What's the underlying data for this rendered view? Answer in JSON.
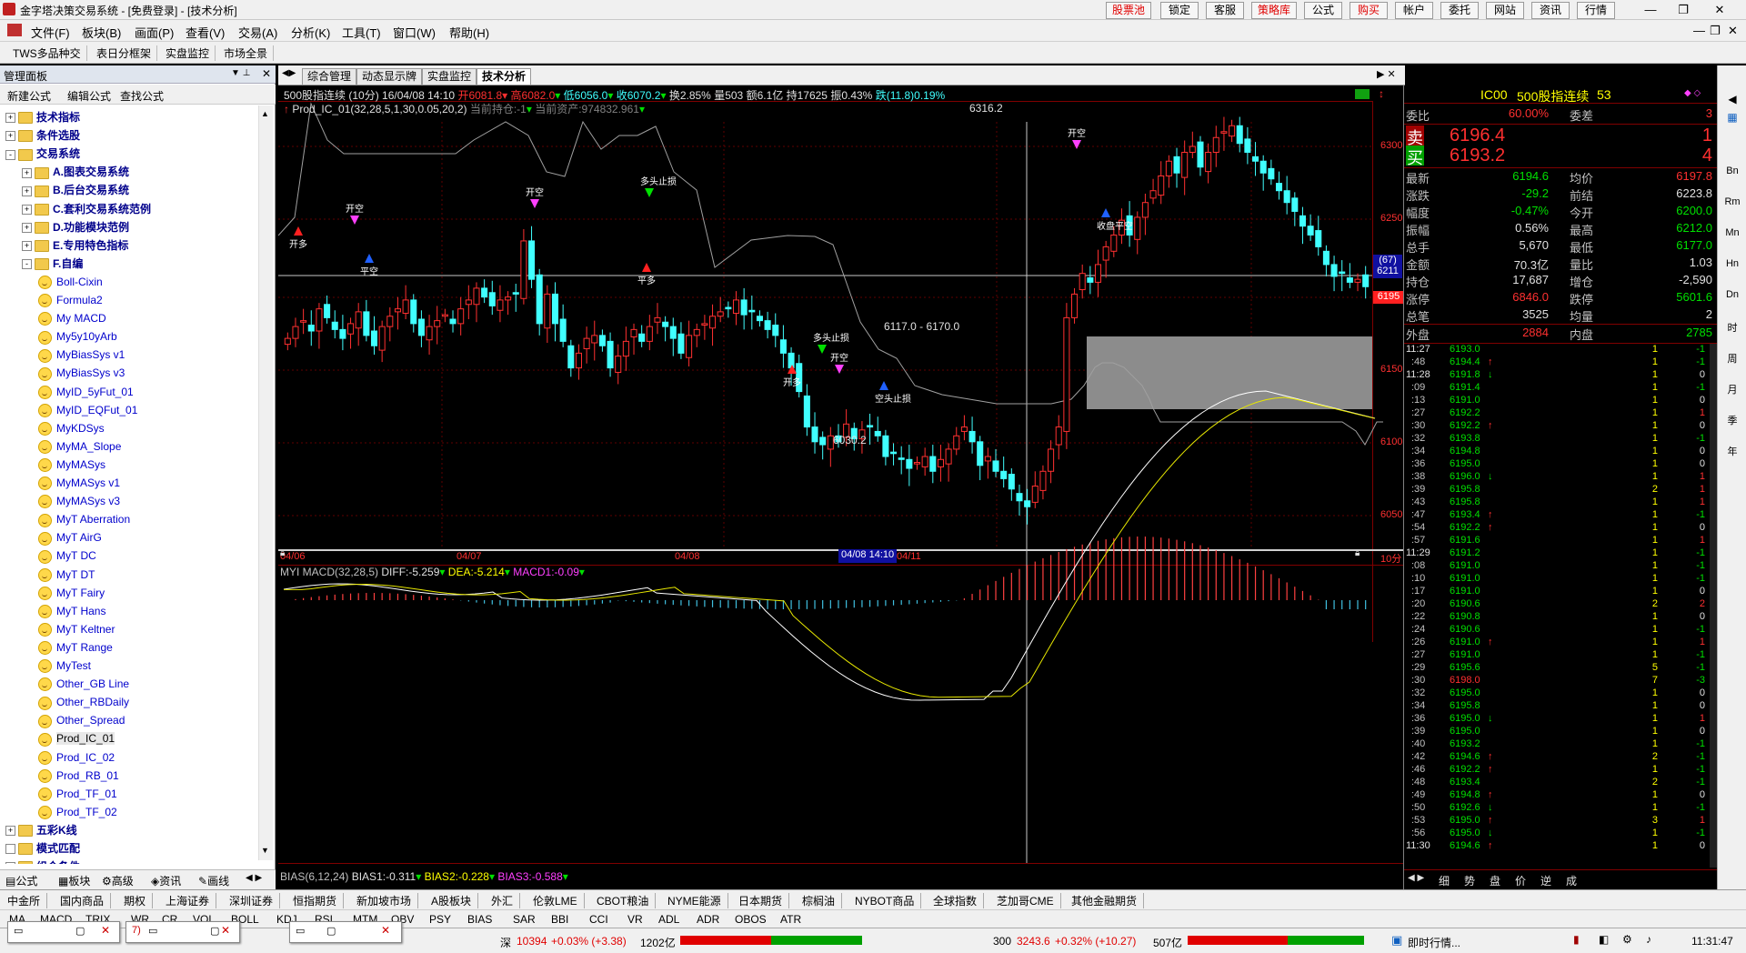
{
  "window": {
    "title": "金字塔决策交易系统 - [免费登录] - [技术分析]",
    "top_buttons": [
      "股票池",
      "锁定",
      "客服",
      "策略库",
      "公式",
      "购买",
      "帐户",
      "委托",
      "网站",
      "资讯",
      "行情"
    ],
    "controls": [
      "—",
      "❐",
      "✕"
    ]
  },
  "menu": {
    "items": [
      "文件(F)",
      "板块(B)",
      "画面(P)",
      "查看(V)",
      "交易(A)",
      "分析(K)",
      "工具(T)",
      "窗口(W)",
      "帮助(H)"
    ]
  },
  "toolbar_tabs": [
    "TWS多品种交",
    "表日分框架",
    "实盘监控",
    "市场全景"
  ],
  "left_panel": {
    "title": "管理面板",
    "tools": [
      "新建公式",
      "编辑公式",
      "查找公式"
    ],
    "tree": [
      {
        "level": 0,
        "type": "folder",
        "label": "技术指标",
        "sign": "+"
      },
      {
        "level": 0,
        "type": "folder",
        "label": "条件选股",
        "sign": "+"
      },
      {
        "level": 0,
        "type": "folder",
        "label": "交易系统",
        "sign": "-"
      },
      {
        "level": 1,
        "type": "folder",
        "label": "A.图表交易系统",
        "sign": "+"
      },
      {
        "level": 1,
        "type": "folder",
        "label": "B.后台交易系统",
        "sign": "+"
      },
      {
        "level": 1,
        "type": "folder",
        "label": "C.套利交易系统范例",
        "sign": "+"
      },
      {
        "level": 1,
        "type": "folder",
        "label": "D.功能模块范例",
        "sign": "+"
      },
      {
        "level": 1,
        "type": "folder",
        "label": "E.专用特色指标",
        "sign": "+"
      },
      {
        "level": 1,
        "type": "folder",
        "label": "F.自编",
        "sign": "-"
      },
      {
        "level": 2,
        "type": "item",
        "label": "Boll-Cixin"
      },
      {
        "level": 2,
        "type": "item",
        "label": "Formula2"
      },
      {
        "level": 2,
        "type": "item",
        "label": "My MACD"
      },
      {
        "level": 2,
        "type": "item",
        "label": "My5y10yArb"
      },
      {
        "level": 2,
        "type": "item",
        "label": "MyBiasSys v1"
      },
      {
        "level": 2,
        "type": "item",
        "label": "MyBiasSys v3"
      },
      {
        "level": 2,
        "type": "item",
        "label": "MyID_5yFut_01"
      },
      {
        "level": 2,
        "type": "item",
        "label": "MyID_EQFut_01"
      },
      {
        "level": 2,
        "type": "item",
        "label": "MyKDSys"
      },
      {
        "level": 2,
        "type": "item",
        "label": "MyMA_Slope"
      },
      {
        "level": 2,
        "type": "item",
        "label": "MyMASys"
      },
      {
        "level": 2,
        "type": "item",
        "label": "MyMASys v1"
      },
      {
        "level": 2,
        "type": "item",
        "label": "MyMASys v3"
      },
      {
        "level": 2,
        "type": "item",
        "label": "MyT Aberration"
      },
      {
        "level": 2,
        "type": "item",
        "label": "MyT AirG"
      },
      {
        "level": 2,
        "type": "item",
        "label": "MyT DC"
      },
      {
        "level": 2,
        "type": "item",
        "label": "MyT DT"
      },
      {
        "level": 2,
        "type": "item",
        "label": "MyT Fairy"
      },
      {
        "level": 2,
        "type": "item",
        "label": "MyT Hans"
      },
      {
        "level": 2,
        "type": "item",
        "label": "MyT Keltner"
      },
      {
        "level": 2,
        "type": "item",
        "label": "MyT Range"
      },
      {
        "level": 2,
        "type": "item",
        "label": "MyTest"
      },
      {
        "level": 2,
        "type": "item",
        "label": "Other_GB Line"
      },
      {
        "level": 2,
        "type": "item",
        "label": "Other_RBDaily"
      },
      {
        "level": 2,
        "type": "item",
        "label": "Other_Spread"
      },
      {
        "level": 2,
        "type": "item",
        "label": "Prod_IC_01"
      },
      {
        "level": 2,
        "type": "item",
        "label": "Prod_IC_02"
      },
      {
        "level": 2,
        "type": "item",
        "label": "Prod_RB_01"
      },
      {
        "level": 2,
        "type": "item",
        "label": "Prod_TF_01"
      },
      {
        "level": 2,
        "type": "item",
        "label": "Prod_TF_02"
      },
      {
        "level": 0,
        "type": "folder",
        "label": "五彩K线",
        "sign": "+"
      },
      {
        "level": 0,
        "type": "folder",
        "label": "模式匹配",
        "sign": " "
      },
      {
        "level": 0,
        "type": "folder",
        "label": "组合条件",
        "sign": " "
      }
    ],
    "bottom_tabs": [
      "公式",
      "板块",
      "高级",
      "资讯",
      "画线"
    ]
  },
  "chart_tabs": [
    "综合管理",
    "动态显示牌",
    "实盘监控",
    "技术分析"
  ],
  "chart": {
    "header": "500股指连续 (10分) 16/04/08 14:10",
    "hdr_open": "开6081.8",
    "hdr_high": "高6082.0",
    "hdr_low": "低6056.0",
    "hdr_close": "收6070.2",
    "hdr_turn": "换2.85%",
    "hdr_vol": "量503",
    "hdr_amt": "额6.1亿",
    "hdr_oi": "持17625",
    "hdr_amp": "振0.43%",
    "hdr_chg": "跌(11.8)0.19%",
    "system_line": "Prod_IC_01(32,28,5,1,30,0.05,20,2)",
    "position": "当前持仓:-1",
    "assets": "当前资产:974832.961",
    "price_labels": [
      "6300",
      "6250",
      "6200",
      "6150",
      "6100",
      "6050"
    ],
    "current_price_tag": "6195",
    "cursor_tag": "(67)\n6211",
    "annotations": {
      "high": "6316.2",
      "low": "6030.2",
      "range": "6117.0 - 6170.0"
    },
    "date_labels": [
      "04/06",
      "04/07",
      "04/08",
      "04/11"
    ],
    "cursor_date": "04/08 14:10",
    "period": "10分",
    "macd_header": "MYI MACD(32,28,5)",
    "macd_diff": "DIFF:-5.259",
    "macd_dea": "DEA:-5.214",
    "macd_m": "MACD1:-0.09",
    "bias_header": "BIAS(6,12,24)",
    "bias1": "BIAS1:-0.311",
    "bias2": "BIAS2:-0.228",
    "bias3": "BIAS3:-0.588",
    "signals": [
      "开多",
      "平空",
      "开空",
      "多头止损",
      "开空",
      "平多",
      "开多",
      "多头止损",
      "开空",
      "空头止损",
      "开空",
      "收盘平空"
    ]
  },
  "quote": {
    "code": "IC00",
    "name": "500股指连续",
    "num": "53",
    "weibi_label": "委比",
    "weibi": "60.00%",
    "weicha_label": "委差",
    "weicha": "3",
    "sell_label": "卖",
    "sell_price": "6196.4",
    "sell_vol": "1",
    "buy_label": "买",
    "buy_price": "6193.2",
    "buy_vol": "4",
    "rows": [
      {
        "l1": "最新",
        "v1": "6194.6",
        "c1": "green",
        "l2": "均价",
        "v2": "6197.8",
        "c2": "red"
      },
      {
        "l1": "涨跌",
        "v1": "-29.2",
        "c1": "green",
        "l2": "前结",
        "v2": "6223.8",
        "c2": "white"
      },
      {
        "l1": "幅度",
        "v1": "-0.47%",
        "c1": "green",
        "l2": "今开",
        "v2": "6200.0",
        "c2": "green"
      },
      {
        "l1": "振幅",
        "v1": "0.56%",
        "c1": "white",
        "l2": "最高",
        "v2": "6212.0",
        "c2": "green"
      },
      {
        "l1": "总手",
        "v1": "5,670",
        "c1": "white",
        "l2": "最低",
        "v2": "6177.0",
        "c2": "green"
      },
      {
        "l1": "金额",
        "v1": "70.3亿",
        "c1": "white",
        "l2": "量比",
        "v2": "1.03",
        "c2": "white"
      },
      {
        "l1": "持仓",
        "v1": "17,687",
        "c1": "white",
        "l2": "增仓",
        "v2": "-2,590",
        "c2": "white"
      },
      {
        "l1": "涨停",
        "v1": "6846.0",
        "c1": "red",
        "l2": "跌停",
        "v2": "5601.6",
        "c2": "green"
      },
      {
        "l1": "总笔",
        "v1": "3525",
        "c1": "white",
        "l2": "均量",
        "v2": "2",
        "c2": "white"
      }
    ],
    "outer_label": "外盘",
    "outer": "2884",
    "inner_label": "内盘",
    "inner": "2785",
    "ticks": [
      {
        "t": "11:27",
        "p": "6193.0",
        "pc": "green",
        "a": "",
        "v": "1",
        "o": "-1",
        "oc": "green"
      },
      {
        "t": ":48",
        "p": "6194.4",
        "pc": "green",
        "a": "↑",
        "v": "1",
        "o": "-1",
        "oc": "green"
      },
      {
        "t": "11:28",
        "p": "6191.8",
        "pc": "green",
        "a": "↓",
        "v": "1",
        "o": "0",
        "oc": "white"
      },
      {
        "t": ":09",
        "p": "6191.4",
        "pc": "green",
        "a": "",
        "v": "1",
        "o": "-1",
        "oc": "green"
      },
      {
        "t": ":13",
        "p": "6191.0",
        "pc": "green",
        "a": "",
        "v": "1",
        "o": "0",
        "oc": "white"
      },
      {
        "t": ":27",
        "p": "6192.2",
        "pc": "green",
        "a": "",
        "v": "1",
        "o": "1",
        "oc": "red"
      },
      {
        "t": ":30",
        "p": "6192.2",
        "pc": "green",
        "a": "↑",
        "v": "1",
        "o": "0",
        "oc": "white"
      },
      {
        "t": ":32",
        "p": "6193.8",
        "pc": "green",
        "a": "",
        "v": "1",
        "o": "-1",
        "oc": "green"
      },
      {
        "t": ":34",
        "p": "6194.8",
        "pc": "green",
        "a": "",
        "v": "1",
        "o": "0",
        "oc": "white"
      },
      {
        "t": ":36",
        "p": "6195.0",
        "pc": "green",
        "a": "",
        "v": "1",
        "o": "0",
        "oc": "white"
      },
      {
        "t": ":38",
        "p": "6196.0",
        "pc": "green",
        "a": "↓",
        "v": "1",
        "o": "1",
        "oc": "red"
      },
      {
        "t": ":39",
        "p": "6195.8",
        "pc": "green",
        "a": "",
        "v": "2",
        "o": "1",
        "oc": "red"
      },
      {
        "t": ":43",
        "p": "6195.8",
        "pc": "green",
        "a": "",
        "v": "1",
        "o": "1",
        "oc": "red"
      },
      {
        "t": ":47",
        "p": "6193.4",
        "pc": "green",
        "a": "↑",
        "v": "1",
        "o": "-1",
        "oc": "green"
      },
      {
        "t": ":54",
        "p": "6192.2",
        "pc": "green",
        "a": "↑",
        "v": "1",
        "o": "0",
        "oc": "white"
      },
      {
        "t": ":57",
        "p": "6191.6",
        "pc": "green",
        "a": "",
        "v": "1",
        "o": "1",
        "oc": "red"
      },
      {
        "t": "11:29",
        "p": "6191.2",
        "pc": "green",
        "a": "",
        "v": "1",
        "o": "-1",
        "oc": "green"
      },
      {
        "t": ":08",
        "p": "6191.0",
        "pc": "green",
        "a": "",
        "v": "1",
        "o": "-1",
        "oc": "green"
      },
      {
        "t": ":10",
        "p": "6191.0",
        "pc": "green",
        "a": "",
        "v": "1",
        "o": "-1",
        "oc": "green"
      },
      {
        "t": ":17",
        "p": "6191.0",
        "pc": "green",
        "a": "",
        "v": "1",
        "o": "0",
        "oc": "white"
      },
      {
        "t": ":20",
        "p": "6190.6",
        "pc": "green",
        "a": "",
        "v": "2",
        "o": "2",
        "oc": "red"
      },
      {
        "t": ":22",
        "p": "6190.8",
        "pc": "green",
        "a": "",
        "v": "1",
        "o": "0",
        "oc": "white"
      },
      {
        "t": ":24",
        "p": "6190.6",
        "pc": "green",
        "a": "",
        "v": "1",
        "o": "-1",
        "oc": "green"
      },
      {
        "t": ":26",
        "p": "6191.0",
        "pc": "green",
        "a": "↑",
        "v": "1",
        "o": "1",
        "oc": "red"
      },
      {
        "t": ":27",
        "p": "6191.0",
        "pc": "green",
        "a": "",
        "v": "1",
        "o": "-1",
        "oc": "green"
      },
      {
        "t": ":29",
        "p": "6195.6",
        "pc": "green",
        "a": "",
        "v": "5",
        "o": "-1",
        "oc": "green"
      },
      {
        "t": ":30",
        "p": "6198.0",
        "pc": "red",
        "a": "",
        "v": "7",
        "o": "-3",
        "oc": "green"
      },
      {
        "t": ":32",
        "p": "6195.0",
        "pc": "green",
        "a": "",
        "v": "1",
        "o": "0",
        "oc": "white"
      },
      {
        "t": ":34",
        "p": "6195.8",
        "pc": "green",
        "a": "",
        "v": "1",
        "o": "0",
        "oc": "white"
      },
      {
        "t": ":36",
        "p": "6195.0",
        "pc": "green",
        "a": "↓",
        "v": "1",
        "o": "1",
        "oc": "red"
      },
      {
        "t": ":39",
        "p": "6195.0",
        "pc": "green",
        "a": "",
        "v": "1",
        "o": "0",
        "oc": "white"
      },
      {
        "t": ":40",
        "p": "6193.2",
        "pc": "green",
        "a": "",
        "v": "1",
        "o": "-1",
        "oc": "green"
      },
      {
        "t": ":42",
        "p": "6194.6",
        "pc": "green",
        "a": "↑",
        "v": "2",
        "o": "-1",
        "oc": "green"
      },
      {
        "t": ":46",
        "p": "6192.2",
        "pc": "green",
        "a": "↑",
        "v": "1",
        "o": "-1",
        "oc": "green"
      },
      {
        "t": ":48",
        "p": "6193.4",
        "pc": "green",
        "a": "",
        "v": "2",
        "o": "-1",
        "oc": "green"
      },
      {
        "t": ":49",
        "p": "6194.8",
        "pc": "green",
        "a": "↑",
        "v": "1",
        "o": "0",
        "oc": "white"
      },
      {
        "t": ":50",
        "p": "6192.6",
        "pc": "green",
        "a": "↓",
        "v": "1",
        "o": "-1",
        "oc": "green"
      },
      {
        "t": ":53",
        "p": "6195.0",
        "pc": "green",
        "a": "↑",
        "v": "3",
        "o": "1",
        "oc": "red"
      },
      {
        "t": ":56",
        "p": "6195.0",
        "pc": "green",
        "a": "↓",
        "v": "1",
        "o": "-1",
        "oc": "green"
      },
      {
        "t": "11:30",
        "p": "6194.6",
        "pc": "green",
        "a": "↑",
        "v": "1",
        "o": "0",
        "oc": "white"
      }
    ],
    "bottom_tabs": [
      "细",
      "势",
      "盘",
      "价",
      "逆",
      "成"
    ]
  },
  "right_sidebar": [
    "Bn",
    "Rm",
    "Mn",
    "Hn",
    "Dn",
    "时",
    "周",
    "月",
    "季",
    "年"
  ],
  "bottom_bar1": [
    "中金所",
    "国内商品",
    "期权",
    "上海证券",
    "深圳证券",
    "恒指期货",
    "新加坡市场",
    "A股板块",
    "外汇",
    "伦敦LME",
    "CBOT粮油",
    "NYME能源",
    "日本期货",
    "棕榈油",
    "NYBOT商品",
    "全球指数",
    "芝加哥CME",
    "其他金融期货"
  ],
  "bottom_bar2": [
    "MA",
    "MACD",
    "TRIX",
    "WR",
    "CR",
    "VOL",
    "BOLL",
    "KDJ",
    "RSI",
    "MTM",
    "OBV",
    "PSY",
    "BIAS",
    "SAR",
    "BBI",
    "CCI",
    "VR",
    "ADL",
    "ADR",
    "OBOS",
    "ATR"
  ],
  "status": {
    "idx1": "深",
    "idx1_val": "10394",
    "idx1_chg": "+0.03% (+3.38)",
    "idx1_amt": "1202亿",
    "idx2": "300",
    "idx2_val": "3243.6",
    "idx2_chg": "+0.32% (+10.27)",
    "idx2_amt": "507亿",
    "feed": "即时行情...",
    "clock": "11:31:47",
    "mini_left": "7)"
  }
}
